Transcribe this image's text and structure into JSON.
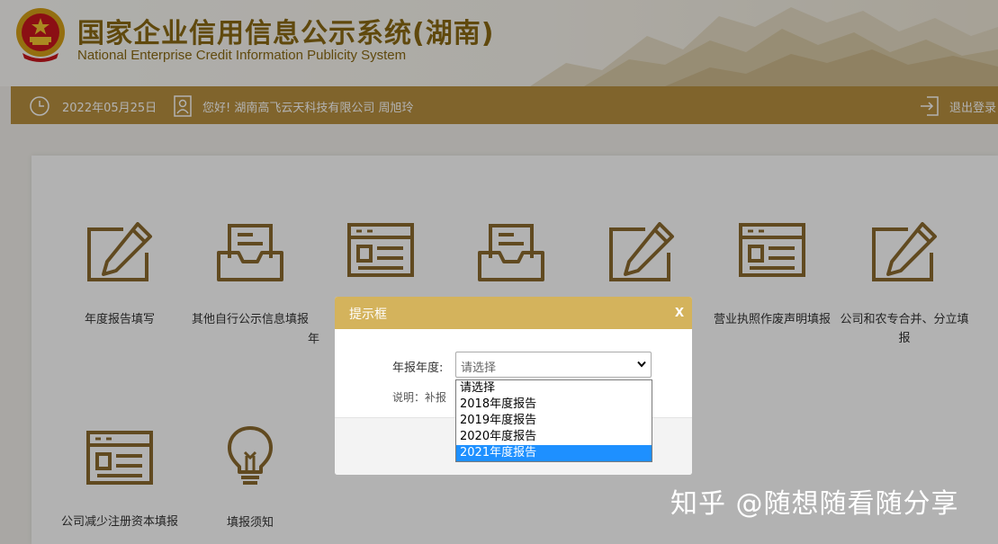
{
  "header": {
    "title": "国家企业信用信息公示系统(湖南)",
    "subtitle": "National Enterprise Credit Information Publicity System"
  },
  "status_bar": {
    "date": "2022年05月25日",
    "greeting": "您好! 湖南高飞云天科技有限公司  周旭玲",
    "logout": "退出登录"
  },
  "tiles": [
    {
      "label": "年度报告填写",
      "icon": "edit-pencil-icon"
    },
    {
      "label": "其他自行公示信息填报",
      "icon": "inbox-tray-icon"
    },
    {
      "label": "年",
      "icon": "form-list-icon"
    },
    {
      "label": "",
      "icon": "inbox-tray-icon"
    },
    {
      "label": "",
      "icon": "edit-pencil-icon"
    },
    {
      "label": "营业执照作废声明填报",
      "icon": "form-list-icon"
    },
    {
      "label": "公司和农专合并、分立填报",
      "icon": "edit-pencil-icon"
    },
    {
      "label": "公司减少注册资本填报",
      "icon": "form-list-icon"
    },
    {
      "label": "填报须知",
      "icon": "lightbulb-icon"
    }
  ],
  "modal": {
    "title": "提示框",
    "close": "x",
    "field_label": "年报年度:",
    "select_value": "请选择",
    "note": "说明：补报",
    "options": [
      "请选择",
      "2018年度报告",
      "2019年度报告",
      "2020年度报告",
      "2021年度报告"
    ],
    "highlighted_option": "2021年度报告"
  },
  "watermark": "知乎 @随想随看随分享",
  "colors": {
    "accent": "#b8903f",
    "title_gold": "#8a6914",
    "modal_header": "#d4b35c",
    "icon_stroke": "#8b6a2e",
    "dropdown_highlight": "#1e90ff"
  }
}
